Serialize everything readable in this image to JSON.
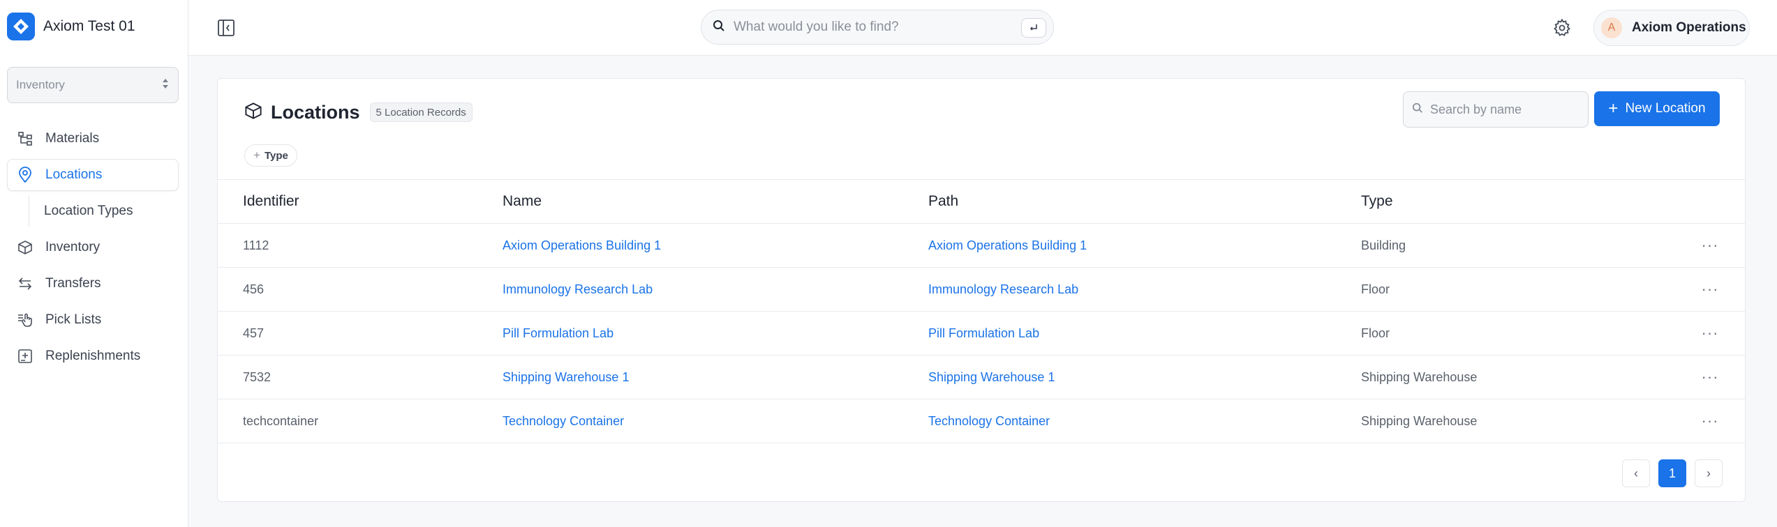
{
  "app": {
    "workspace_name": "Axiom Test 01"
  },
  "sidebar": {
    "module_select": {
      "value": "Inventory"
    },
    "items": [
      {
        "label": "Materials",
        "icon": "hierarchy-icon",
        "active": false
      },
      {
        "label": "Locations",
        "icon": "map-pin-icon",
        "active": true
      },
      {
        "label": "Location Types",
        "icon": "",
        "active": false,
        "sub": true
      },
      {
        "label": "Inventory",
        "icon": "box-icon",
        "active": false
      },
      {
        "label": "Transfers",
        "icon": "transfer-arrows-icon",
        "active": false
      },
      {
        "label": "Pick Lists",
        "icon": "pick-list-icon",
        "active": false
      },
      {
        "label": "Replenishments",
        "icon": "replenish-icon",
        "active": false
      }
    ]
  },
  "header": {
    "search": {
      "placeholder": "What would you like to find?",
      "value": ""
    },
    "user": {
      "initial": "A",
      "name": "Axiom Operations"
    }
  },
  "page": {
    "title": "Locations",
    "record_count": "5 Location Records",
    "search": {
      "placeholder": "Search by name",
      "value": ""
    },
    "new_button_label": "New Location",
    "filter_chip_label": "Type",
    "table": {
      "columns": [
        "Identifier",
        "Name",
        "Path",
        "Type"
      ],
      "rows": [
        {
          "identifier": "1112",
          "name": "Axiom Operations Building 1",
          "path": "Axiom Operations Building 1",
          "type": "Building"
        },
        {
          "identifier": "456",
          "name": "Immunology Research Lab",
          "path": "Immunology Research Lab",
          "type": "Floor"
        },
        {
          "identifier": "457",
          "name": "Pill Formulation Lab",
          "path": "Pill Formulation Lab",
          "type": "Floor"
        },
        {
          "identifier": "7532",
          "name": "Shipping Warehouse 1",
          "path": "Shipping Warehouse 1",
          "type": "Shipping Warehouse"
        },
        {
          "identifier": "techcontainer",
          "name": "Technology Container",
          "path": "Technology Container",
          "type": "Shipping Warehouse"
        }
      ]
    },
    "pagination": {
      "prev": "‹",
      "current": "1",
      "next": "›"
    }
  },
  "colors": {
    "accent": "#1a73e8",
    "border": "#e6e8ec",
    "muted_text": "#5a606b"
  }
}
